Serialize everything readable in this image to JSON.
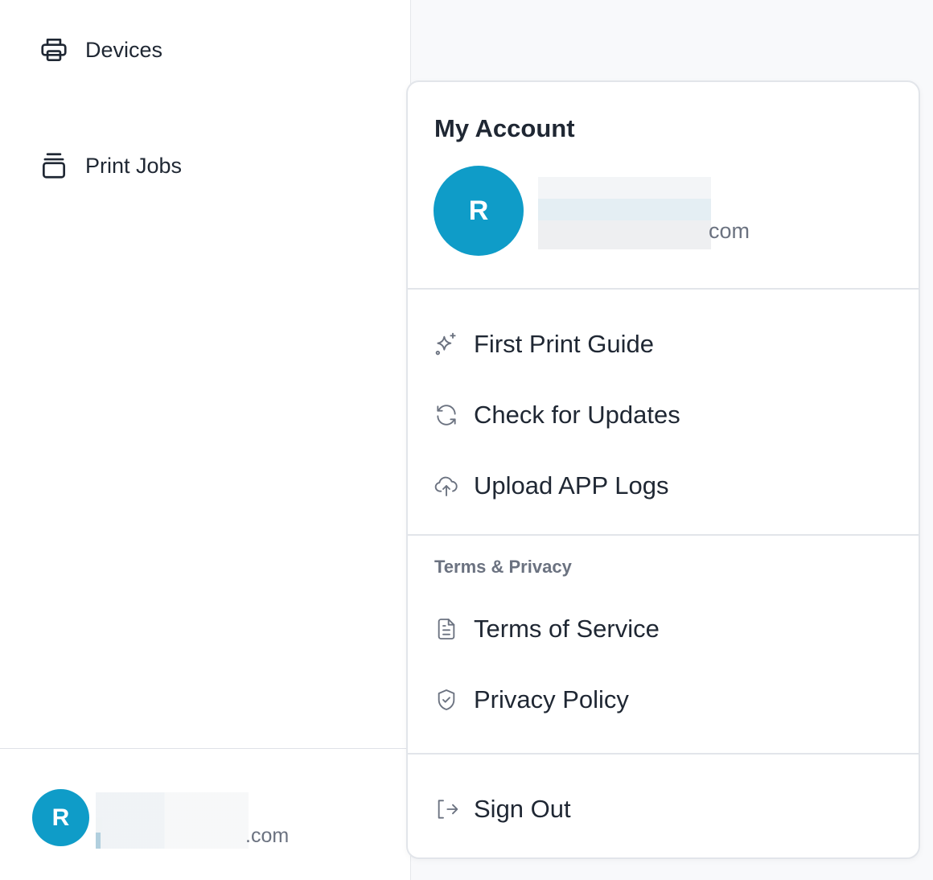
{
  "sidebar": {
    "items": [
      {
        "label": "Devices",
        "icon": "printer-icon"
      },
      {
        "label": "Print Jobs",
        "icon": "stack-icon"
      }
    ],
    "footer": {
      "avatar_initial": "R",
      "email_suffix": ".com"
    }
  },
  "account_menu": {
    "title": "My Account",
    "avatar_initial": "R",
    "email_suffix": "com",
    "tools": [
      {
        "label": "First Print Guide",
        "icon": "sparkle-icon"
      },
      {
        "label": "Check for Updates",
        "icon": "refresh-icon"
      },
      {
        "label": "Upload APP Logs",
        "icon": "cloud-upload-icon"
      }
    ],
    "legal_heading": "Terms & Privacy",
    "legal": [
      {
        "label": "Terms of Service",
        "icon": "document-icon"
      },
      {
        "label": "Privacy Policy",
        "icon": "shield-check-icon"
      }
    ],
    "sign_out": {
      "label": "Sign Out",
      "icon": "sign-out-icon"
    }
  },
  "colors": {
    "accent": "#0f9cc8",
    "text": "#1f2733",
    "muted": "#6b7280",
    "border": "#e2e5ea"
  }
}
